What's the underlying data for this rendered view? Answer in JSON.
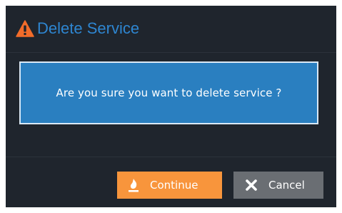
{
  "dialog": {
    "title": "Delete Service",
    "title_icon": "warning-triangle-icon",
    "message": "Are you sure you want to delete service ?"
  },
  "actions": {
    "continue_label": "Continue",
    "continue_icon": "fire-icon",
    "cancel_label": "Cancel",
    "cancel_icon": "close-x-icon"
  },
  "colors": {
    "dialog_background": "#1f252d",
    "title": "#2e86d1",
    "message_background": "#2a7fc0",
    "message_border": "#d9e8f5",
    "warning": "#f26c2a",
    "continue_button": "#f8953c",
    "cancel_button": "#6a6e73"
  }
}
